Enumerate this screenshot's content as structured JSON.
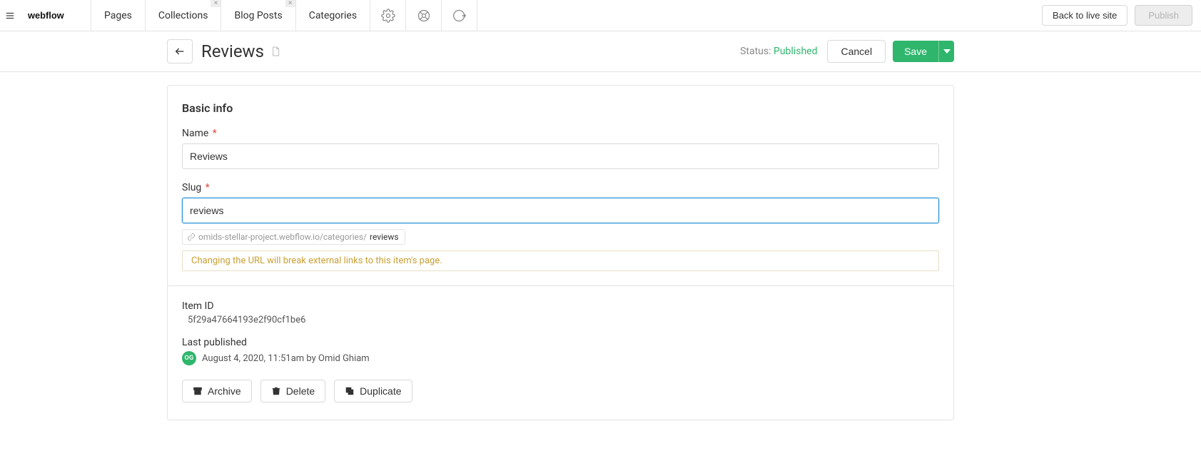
{
  "topbar": {
    "tabs": [
      {
        "label": "Pages",
        "closable": false
      },
      {
        "label": "Collections",
        "closable": true
      },
      {
        "label": "Blog Posts",
        "closable": true
      },
      {
        "label": "Categories",
        "closable": false,
        "active": true
      }
    ],
    "back_to_site": "Back to live site",
    "publish": "Publish"
  },
  "subheader": {
    "title": "Reviews",
    "status_label": "Status:",
    "status_value": "Published",
    "cancel": "Cancel",
    "save": "Save"
  },
  "form": {
    "section_title": "Basic info",
    "name_label": "Name",
    "required_mark": "*",
    "name_value": "Reviews",
    "slug_label": "Slug",
    "slug_value": "reviews",
    "url_base": "omids-stellar-project.webflow.io/categories/",
    "url_slug": "reviews",
    "warning": "Changing the URL will break external links to this item's page."
  },
  "meta": {
    "item_id_label": "Item ID",
    "item_id_value": "5f29a47664193e2f90cf1be6",
    "last_pub_label": "Last published",
    "avatar_initials": "OG",
    "last_pub_value": "August 4, 2020, 11:51am by Omid Ghiam"
  },
  "actions": {
    "archive": "Archive",
    "delete": "Delete",
    "duplicate": "Duplicate"
  }
}
